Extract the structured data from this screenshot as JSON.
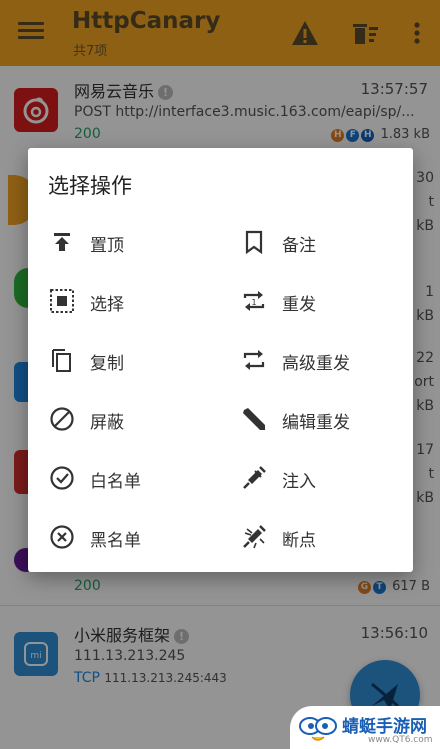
{
  "appbar": {
    "title": "HttpCanary",
    "subtitle": "共7项",
    "color": "#f5a623",
    "icons": [
      "menu-icon",
      "warning-icon",
      "clear-icon",
      "more-vert-icon"
    ]
  },
  "list": {
    "rows": [
      {
        "name": "网易云音乐",
        "time": "13:57:57",
        "url": "POST http://interface3.music.163.com/eapi/sp/...",
        "status": "200",
        "size": "1.83 kB",
        "badges": [
          "H",
          "F",
          "H"
        ]
      },
      {
        "name": "小米服务框架",
        "time": "13:56:10",
        "host": "111.13.213.245",
        "protocol": "TCP",
        "address": "111.13.213.245:443"
      }
    ],
    "partial": {
      "status": "200",
      "size": "617 B",
      "badges": [
        "G",
        "T"
      ]
    },
    "edge_fragments": [
      "30",
      "t",
      "kB",
      "1",
      "kB",
      "22",
      "ort",
      "kB",
      "17",
      "t",
      "kB"
    ]
  },
  "dialog": {
    "title": "选择操作",
    "options": [
      {
        "label": "置顶",
        "icon": "pin-top-icon"
      },
      {
        "label": "备注",
        "icon": "bookmark-icon"
      },
      {
        "label": "选择",
        "icon": "select-icon"
      },
      {
        "label": "重发",
        "icon": "resend-icon"
      },
      {
        "label": "复制",
        "icon": "copy-icon"
      },
      {
        "label": "高级重发",
        "icon": "advanced-resend-icon"
      },
      {
        "label": "屏蔽",
        "icon": "block-icon"
      },
      {
        "label": "编辑重发",
        "icon": "edit-resend-icon"
      },
      {
        "label": "白名单",
        "icon": "whitelist-icon"
      },
      {
        "label": "注入",
        "icon": "inject-icon"
      },
      {
        "label": "黑名单",
        "icon": "blacklist-icon"
      },
      {
        "label": "断点",
        "icon": "breakpoint-icon"
      }
    ]
  },
  "watermark": {
    "text": "蜻蜓手游网",
    "sub": "www.QT6.com"
  }
}
